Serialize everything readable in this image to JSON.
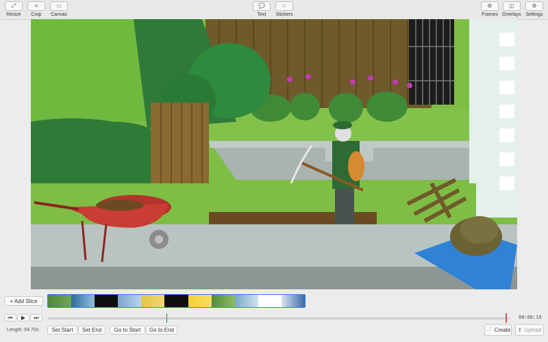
{
  "toolbar": {
    "left": [
      {
        "label": "Resize",
        "icon": "resize-icon",
        "glyph": "⤢"
      },
      {
        "label": "Crop",
        "icon": "crop-icon",
        "glyph": "⌗"
      },
      {
        "label": "Canvas",
        "icon": "canvas-icon",
        "glyph": "▭"
      }
    ],
    "center": [
      {
        "label": "Text",
        "icon": "speech-bubble-icon",
        "glyph": "💬"
      },
      {
        "label": "Stickers",
        "icon": "star-icon",
        "glyph": "☆"
      }
    ],
    "right": [
      {
        "label": "Frames",
        "icon": "frames-icon",
        "glyph": "⚙"
      },
      {
        "label": "Overlays",
        "icon": "overlays-icon",
        "glyph": "◫"
      },
      {
        "label": "Settings",
        "icon": "gear-icon",
        "glyph": "⚙"
      }
    ]
  },
  "slice": {
    "add_label": "+ Add Slice"
  },
  "playback": {
    "skip_back": "⏮",
    "play": "▶",
    "skip_forward": "⏭"
  },
  "time_display": "00:00:19",
  "length_label": "Length: 54.70s",
  "buttons": {
    "set_start": "Set Start",
    "set_end": "Set End",
    "go_to_start": "Go to Start",
    "go_to_end": "Go to End",
    "create": "Create",
    "upload": "Upload"
  },
  "colors": {
    "accent": "#2f7cf6",
    "start_marker": "#2e8b57",
    "end_marker": "#d9534f"
  }
}
